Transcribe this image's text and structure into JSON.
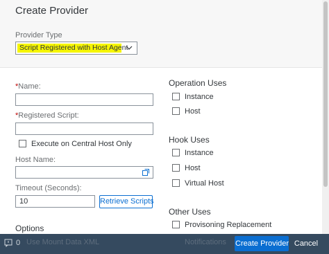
{
  "dialog": {
    "title": "Create Provider",
    "provider_type": {
      "label": "Provider Type",
      "selected": "Script Registered with Host Agent",
      "icon": "chevron-down-icon"
    }
  },
  "form": {
    "name": {
      "required_mark": "*",
      "label": "Name:",
      "value": ""
    },
    "registered_script": {
      "required_mark": "*",
      "label": "Registered Script:",
      "value": ""
    },
    "execute_central": {
      "label": "Execute on Central Host Only",
      "checked": false
    },
    "host_name": {
      "label": "Host Name:",
      "value": "",
      "icon": "value-help-icon"
    },
    "timeout": {
      "label": "Timeout (Seconds):",
      "value": "10"
    },
    "retrieve_scripts_label": "Retrieve Scripts",
    "options": {
      "title": "Options",
      "use_mount_data": "Use Mount Data XML"
    }
  },
  "operation_uses": {
    "title": "Operation Uses",
    "items": [
      {
        "label": "Instance",
        "checked": false
      },
      {
        "label": "Host",
        "checked": false
      }
    ]
  },
  "hook_uses": {
    "title": "Hook Uses",
    "items": [
      {
        "label": "Instance",
        "checked": false
      },
      {
        "label": "Host",
        "checked": false
      },
      {
        "label": "Virtual Host",
        "checked": false
      }
    ]
  },
  "other_uses": {
    "title": "Other Uses",
    "items": [
      {
        "label": "Provisoning Replacement",
        "checked": false
      },
      {
        "label": "Notifications",
        "checked": false
      }
    ]
  },
  "footer": {
    "message_count": "0",
    "message_icon": "message-popover-icon",
    "create_label": "Create Provider",
    "cancel_label": "Cancel"
  },
  "colors": {
    "primary": "#0a6ed1",
    "footer_bg": "#354a5f",
    "highlight": "#f5f500",
    "required": "#bb0000"
  }
}
